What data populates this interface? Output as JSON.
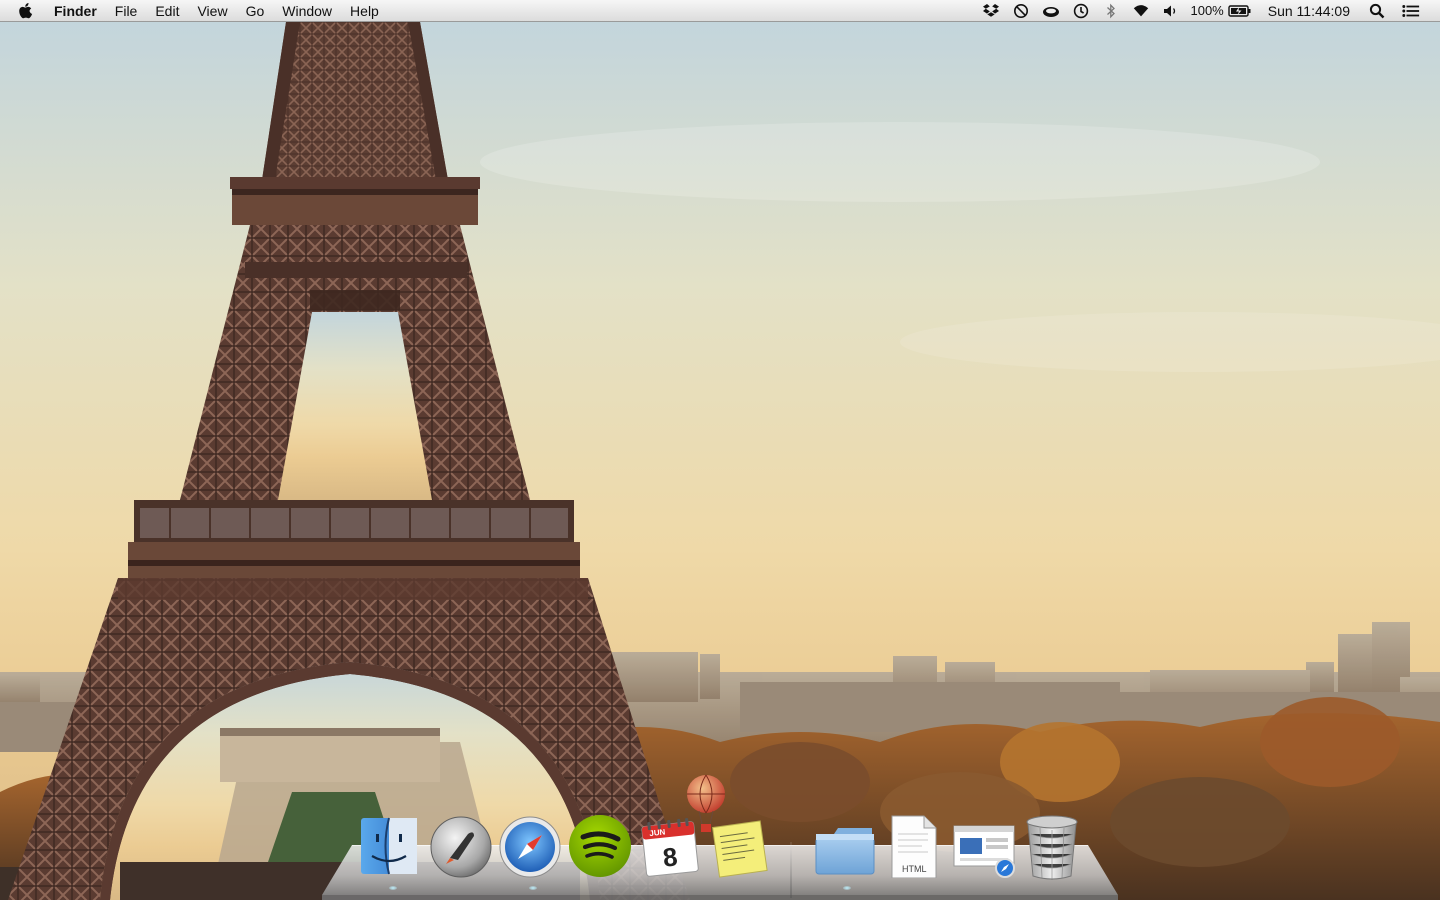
{
  "menubar": {
    "apple_icon": "apple-icon",
    "app_name": "Finder",
    "menus": [
      "File",
      "Edit",
      "View",
      "Go",
      "Window",
      "Help"
    ],
    "status": {
      "icons": [
        "dropbox-icon",
        "do-not-disturb-icon",
        "cloud-sync-icon",
        "time-machine-icon",
        "bluetooth-icon",
        "wifi-icon",
        "volume-icon"
      ],
      "battery_percent": "100%",
      "clock": "Sun 11:44:09",
      "spotlight_icon": "spotlight-search-icon",
      "notification_icon": "notification-center-icon"
    }
  },
  "dock": {
    "apps": [
      {
        "name": "Finder",
        "icon": "finder-icon",
        "running": true
      },
      {
        "name": "Launchpad",
        "icon": "launchpad-icon",
        "running": false
      },
      {
        "name": "Safari",
        "icon": "safari-icon",
        "running": true
      },
      {
        "name": "Spotify",
        "icon": "spotify-icon",
        "running": false
      },
      {
        "name": "Calendar",
        "icon": "calendar-icon",
        "running": false,
        "month": "JUN",
        "day": "8"
      },
      {
        "name": "Stickies",
        "icon": "stickies-icon",
        "running": false
      },
      {
        "name": "Balloon",
        "icon": "hot-air-balloon-icon",
        "running": false
      }
    ],
    "stacks": [
      {
        "name": "Documents",
        "icon": "folder-stack-icon",
        "running": true
      },
      {
        "name": "HTML file",
        "icon": "html-document-icon",
        "label": "HTML",
        "running": false
      },
      {
        "name": "Safari web page",
        "icon": "webpage-document-icon",
        "running": false
      },
      {
        "name": "Trash",
        "icon": "trash-icon",
        "running": false
      }
    ]
  },
  "colors": {
    "sky_top": "#c9d8dc",
    "sky_mid": "#efdcae",
    "tower": "#6e4a3a",
    "spotify_green": "#84bd00",
    "safari_blue": "#2a78d8"
  }
}
